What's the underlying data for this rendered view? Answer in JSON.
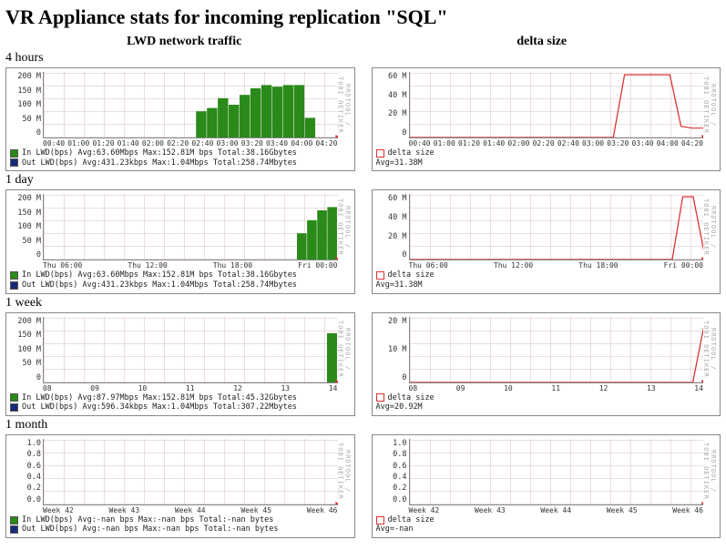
{
  "title": "VR Appliance stats for incoming replication \"SQL\"",
  "columns": {
    "left": "LWD network traffic",
    "right": "delta size"
  },
  "side_caption": "RRDTOOL / TOBI OETIKER",
  "chart_data": [
    {
      "id": "network-4h",
      "type": "bar",
      "title": "LWD network traffic — 4 hours",
      "ylabel": "bps",
      "ylim": [
        0,
        200
      ],
      "yunit": "M",
      "yticks": [
        "200 M",
        "150 M",
        "100 M",
        "50 M",
        "0"
      ],
      "xticks": [
        "00:40",
        "01:00",
        "01:20",
        "01:40",
        "02:00",
        "02:20",
        "02:40",
        "03:00",
        "03:20",
        "03:40",
        "04:00",
        "04:20"
      ],
      "series": [
        {
          "name": "In LWD(bps)",
          "color": "green",
          "avg": "63.60Mbps",
          "max": "152.81M bps",
          "total": "38.16Gbytes",
          "values": [
            0,
            0,
            0,
            0,
            0,
            0,
            0,
            0,
            0,
            0,
            0,
            0,
            0,
            0,
            80,
            90,
            120,
            100,
            130,
            150,
            160,
            155,
            160,
            160,
            60,
            0,
            0
          ]
        },
        {
          "name": "Out LWD(bps)",
          "color": "blue",
          "avg": "431.23kbps",
          "max": "1.04Mbps",
          "total": "258.74Mbytes",
          "values": []
        }
      ]
    },
    {
      "id": "delta-4h",
      "type": "line",
      "title": "delta size — 4 hours",
      "ylim": [
        0,
        70
      ],
      "yunit": "M",
      "yticks": [
        "60 M",
        "40 M",
        "20 M",
        "0"
      ],
      "xticks": [
        "00:40",
        "01:00",
        "01:20",
        "01:40",
        "02:00",
        "02:20",
        "02:40",
        "03:00",
        "03:20",
        "03:40",
        "04:00",
        "04:20"
      ],
      "series": [
        {
          "name": "delta size",
          "color": "red",
          "avg": "31.38M",
          "values": [
            0,
            0,
            0,
            0,
            0,
            0,
            0,
            0,
            0,
            0,
            0,
            0,
            0,
            0,
            0,
            0,
            0,
            0,
            0,
            67,
            67,
            67,
            67,
            67,
            12,
            10,
            10
          ]
        }
      ]
    },
    {
      "id": "network-1d",
      "type": "bar",
      "title": "LWD network traffic — 1 day",
      "ylim": [
        0,
        200
      ],
      "yunit": "M",
      "yticks": [
        "200 M",
        "150 M",
        "100 M",
        "50 M",
        "0"
      ],
      "xticks": [
        "Thu 06:00",
        "Thu 12:00",
        "Thu 18:00",
        "Fri 00:00"
      ],
      "series": [
        {
          "name": "In LWD(bps)",
          "color": "green",
          "avg": "63.60Mbps",
          "max": "152.81M bps",
          "total": "38.16Gbytes",
          "values": [
            0,
            0,
            0,
            0,
            0,
            0,
            0,
            0,
            0,
            0,
            0,
            0,
            0,
            0,
            0,
            0,
            0,
            0,
            0,
            0,
            0,
            0,
            0,
            0,
            0,
            80,
            120,
            150,
            160
          ]
        },
        {
          "name": "Out LWD(bps)",
          "color": "blue",
          "avg": "431.23kbps",
          "max": "1.04Mbps",
          "total": "258.74Mbytes",
          "values": []
        }
      ]
    },
    {
      "id": "delta-1d",
      "type": "line",
      "title": "delta size — 1 day",
      "ylim": [
        0,
        70
      ],
      "yunit": "M",
      "yticks": [
        "60 M",
        "40 M",
        "20 M",
        "0"
      ],
      "xticks": [
        "Thu 06:00",
        "Thu 12:00",
        "Thu 18:00",
        "Fri 00:00"
      ],
      "series": [
        {
          "name": "delta size",
          "color": "red",
          "avg": "31.38M",
          "values": [
            0,
            0,
            0,
            0,
            0,
            0,
            0,
            0,
            0,
            0,
            0,
            0,
            0,
            0,
            0,
            0,
            0,
            0,
            0,
            0,
            0,
            0,
            0,
            0,
            0,
            0,
            67,
            67,
            10
          ]
        }
      ]
    },
    {
      "id": "network-1w",
      "type": "bar",
      "title": "LWD network traffic — 1 week",
      "ylim": [
        0,
        200
      ],
      "yunit": "M",
      "yticks": [
        "200 M",
        "150 M",
        "100 M",
        "50 M",
        "0"
      ],
      "xticks": [
        "08",
        "09",
        "10",
        "11",
        "12",
        "13",
        "14"
      ],
      "series": [
        {
          "name": "In LWD(bps)",
          "color": "green",
          "avg": "87.97Mbps",
          "max": "152.81M bps",
          "total": "45.32Gbytes",
          "values": [
            0,
            0,
            0,
            0,
            0,
            0,
            0,
            0,
            0,
            0,
            0,
            0,
            0,
            0,
            0,
            0,
            0,
            0,
            0,
            0,
            0,
            0,
            0,
            0,
            0,
            0,
            0,
            150
          ]
        },
        {
          "name": "Out LWD(bps)",
          "color": "blue",
          "avg": "596.34kbps",
          "max": "1.04Mbps",
          "total": "307.22Mbytes",
          "values": []
        }
      ]
    },
    {
      "id": "delta-1w",
      "type": "line",
      "title": "delta size — 1 week",
      "ylim": [
        0,
        25
      ],
      "yunit": "M",
      "yticks": [
        "20 M",
        "10 M",
        "0"
      ],
      "xticks": [
        "08",
        "09",
        "10",
        "11",
        "12",
        "13",
        "14"
      ],
      "series": [
        {
          "name": "delta size",
          "color": "red",
          "avg": "20.92M",
          "values": [
            0,
            0,
            0,
            0,
            0,
            0,
            0,
            0,
            0,
            0,
            0,
            0,
            0,
            0,
            0,
            0,
            0,
            0,
            0,
            0,
            0,
            0,
            0,
            0,
            0,
            0,
            0,
            21
          ]
        }
      ]
    },
    {
      "id": "network-1m",
      "type": "bar",
      "title": "LWD network traffic — 1 month",
      "ylim": [
        0,
        1
      ],
      "yunit": "",
      "yticks": [
        "1.0",
        "0.8",
        "0.6",
        "0.4",
        "0.2",
        "0.0"
      ],
      "xticks": [
        "Week 42",
        "Week 43",
        "Week 44",
        "Week 45",
        "Week 46"
      ],
      "series": [
        {
          "name": "In LWD(bps)",
          "color": "green",
          "avg": "-nan bps",
          "max": "-nan  bps",
          "total": "-nan bytes",
          "values": []
        },
        {
          "name": "Out LWD(bps)",
          "color": "blue",
          "avg": "-nan bps",
          "max": "-nan  bps",
          "total": "-nan bytes",
          "values": []
        }
      ]
    },
    {
      "id": "delta-1m",
      "type": "line",
      "title": "delta size — 1 month",
      "ylim": [
        0,
        1
      ],
      "yunit": "",
      "yticks": [
        "1.0",
        "0.8",
        "0.6",
        "0.4",
        "0.2",
        "0.0"
      ],
      "xticks": [
        "Week 42",
        "Week 43",
        "Week 44",
        "Week 45",
        "Week 46"
      ],
      "series": [
        {
          "name": "delta size",
          "color": "red",
          "avg": "-nan",
          "values": []
        }
      ]
    }
  ],
  "rows": [
    {
      "label": "4 hours",
      "left": "network-4h",
      "right": "delta-4h"
    },
    {
      "label": "1 day",
      "left": "network-1d",
      "right": "delta-1d"
    },
    {
      "label": "1 week",
      "left": "network-1w",
      "right": "delta-1w"
    },
    {
      "label": "1 month",
      "left": "network-1m",
      "right": "delta-1m"
    }
  ]
}
